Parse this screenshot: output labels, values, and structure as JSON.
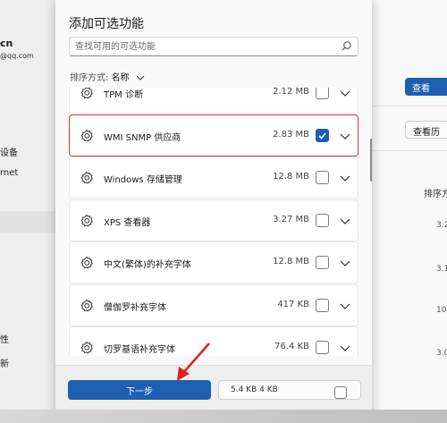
{
  "background": {
    "profile": {
      "name": "cn",
      "email": "@qq.com"
    },
    "nav": [
      {
        "label": "设备",
        "top": 0
      },
      {
        "label": "rnet",
        "top": 0
      },
      {
        "label": "性",
        "top": 0
      },
      {
        "label": "新",
        "top": 0
      }
    ],
    "right_primary": "查看",
    "right_secondary": "查看历",
    "column_header": "排序方",
    "values": [
      "3.2",
      "3.1",
      "10.",
      "3.0"
    ]
  },
  "dialog": {
    "title": "添加可选功能",
    "search_placeholder": "查找可用的可选功能",
    "sort_label": "排序方式:",
    "sort_value": "名称",
    "items": [
      {
        "name": "TPM 诊断",
        "size": "2.12 MB",
        "checked": false
      },
      {
        "name": "WMI SNMP 供应商",
        "size": "2.83 MB",
        "checked": true
      },
      {
        "name": "Windows 存储管理",
        "size": "12.8 MB",
        "checked": false
      },
      {
        "name": "XPS 查看器",
        "size": "3.27 MB",
        "checked": false
      },
      {
        "name": "中文(繁体)的补充字体",
        "size": "12.8 MB",
        "checked": false
      },
      {
        "name": "僧伽罗补充字体",
        "size": "417 KB",
        "checked": false
      },
      {
        "name": "切罗基语补充字体",
        "size": "76.4 KB",
        "checked": false
      }
    ],
    "next_label": "下一步",
    "footer_partial": "5.4 KB 4 KB"
  },
  "colors": {
    "accent": "#1f5fb0",
    "highlight": "#d63a3a"
  }
}
